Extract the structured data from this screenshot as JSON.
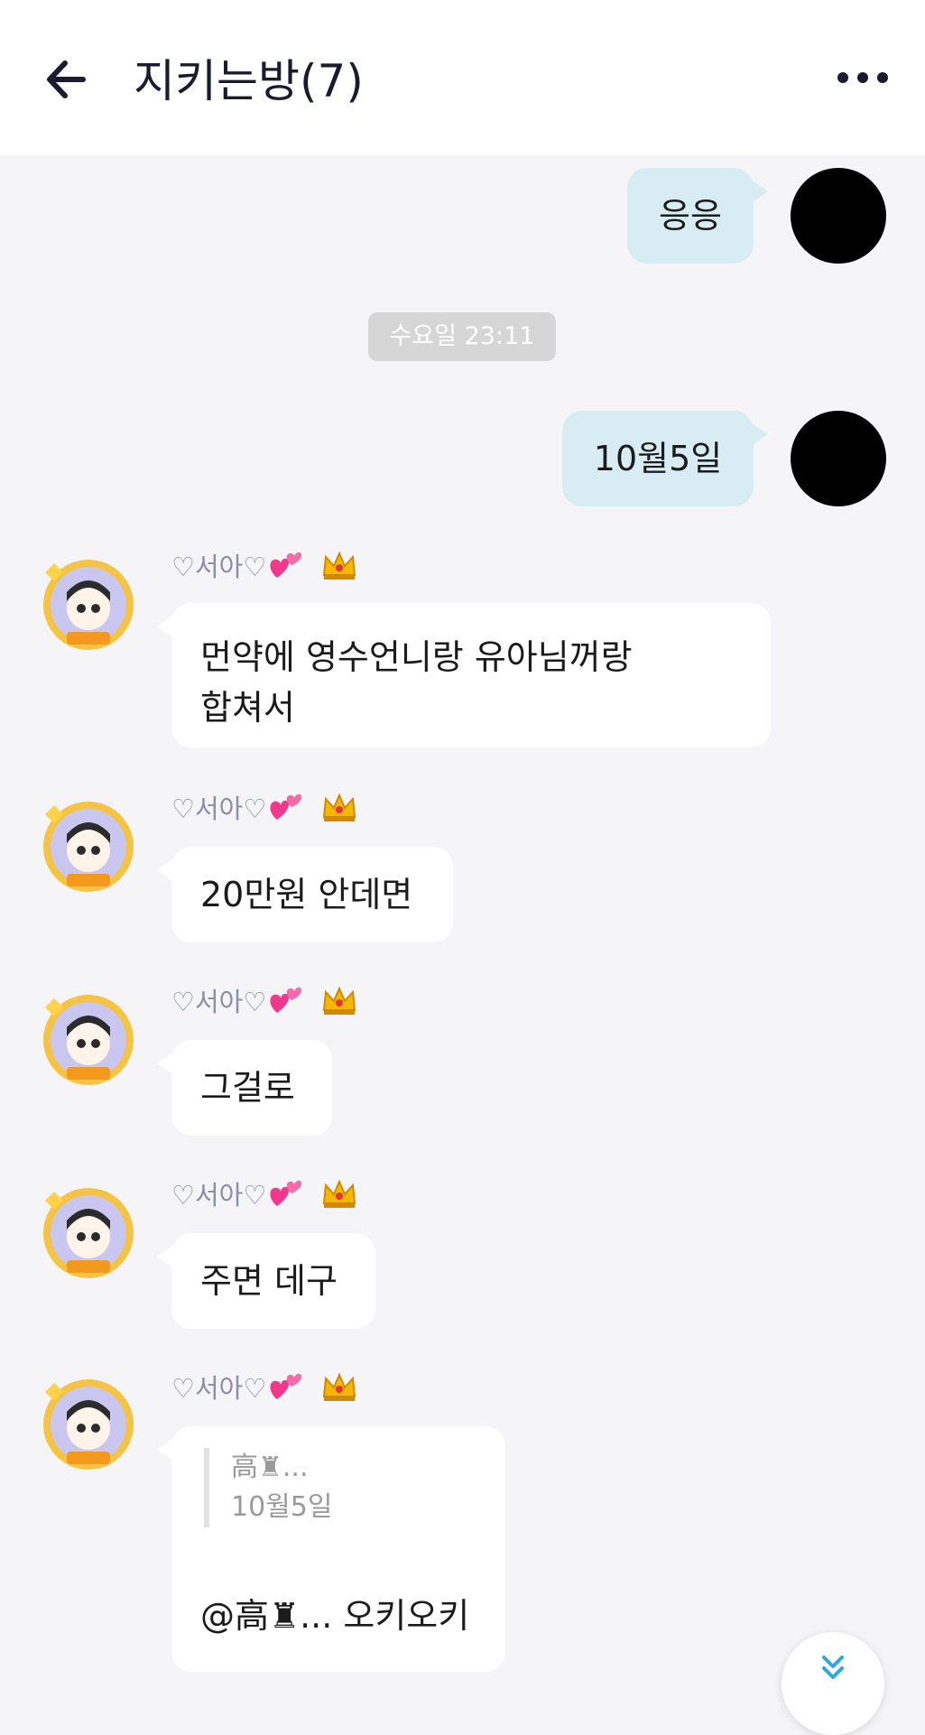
{
  "header": {
    "title": "지키는방(7)",
    "back_icon": "arrow-left-icon",
    "more_icon": "more-horizontal-icon"
  },
  "messages": {
    "mine_1": "응응",
    "date_divider": "수요일 23:11",
    "mine_2": "10월5일",
    "sender_name": "♡서아♡",
    "others": [
      {
        "text": "먼약에 영수언니랑 유아님꺼랑\n합쳐서"
      },
      {
        "text": "20만원 안데면"
      },
      {
        "text": "그걸로"
      },
      {
        "text": "주면 데구"
      }
    ],
    "reply": {
      "quoted_author": "高♜...",
      "quoted_text": "10월5일",
      "text": "@高♜... 오키오키"
    }
  },
  "colors": {
    "my_bubble": "#d8ecf4",
    "other_bubble": "#ffffff",
    "background": "#f5f5f7",
    "accent_scroll": "#2ea7e0"
  },
  "icons": {
    "scroll_down": "chevron-double-down-icon",
    "heart": "hearts-emoji-icon",
    "crown": "crown-badge-icon"
  }
}
